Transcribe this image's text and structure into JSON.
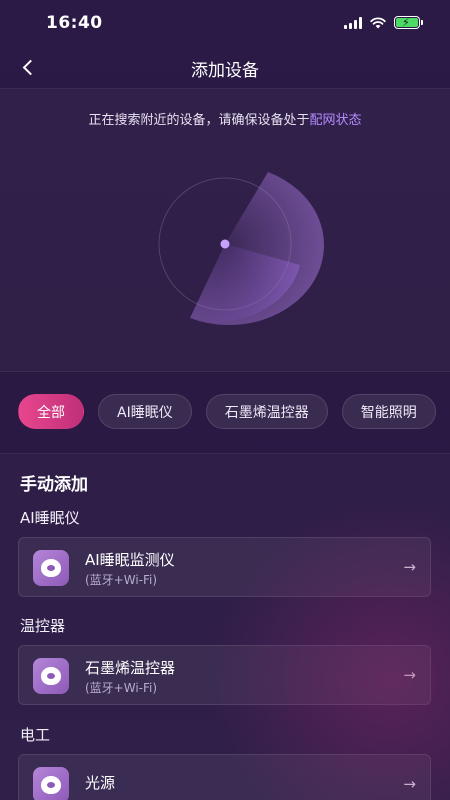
{
  "status_bar": {
    "time": "16:40"
  },
  "nav": {
    "title": "添加设备"
  },
  "search": {
    "hint_text": "正在搜索附近的设备，请确保设备处于",
    "hint_link": "配网状态"
  },
  "filters": [
    {
      "label": "全部",
      "active": true
    },
    {
      "label": "AI睡眠仪",
      "active": false
    },
    {
      "label": "石墨烯温控器",
      "active": false
    },
    {
      "label": "智能照明",
      "active": false
    }
  ],
  "manual": {
    "title": "手动添加",
    "categories": [
      {
        "label": "AI睡眠仪",
        "device": {
          "name": "AI睡眠监测仪",
          "sub": "(蓝牙+Wi-Fi)"
        }
      },
      {
        "label": "温控器",
        "device": {
          "name": "石墨烯温控器",
          "sub": "(蓝牙+Wi-Fi)"
        }
      },
      {
        "label": "电工",
        "device": {
          "name": "光源",
          "sub": ""
        }
      }
    ],
    "arrow_symbol": "→"
  },
  "colors": {
    "accent_pink": "#e8468d",
    "link_purple": "#b58cff",
    "background": "#2a1a45"
  }
}
